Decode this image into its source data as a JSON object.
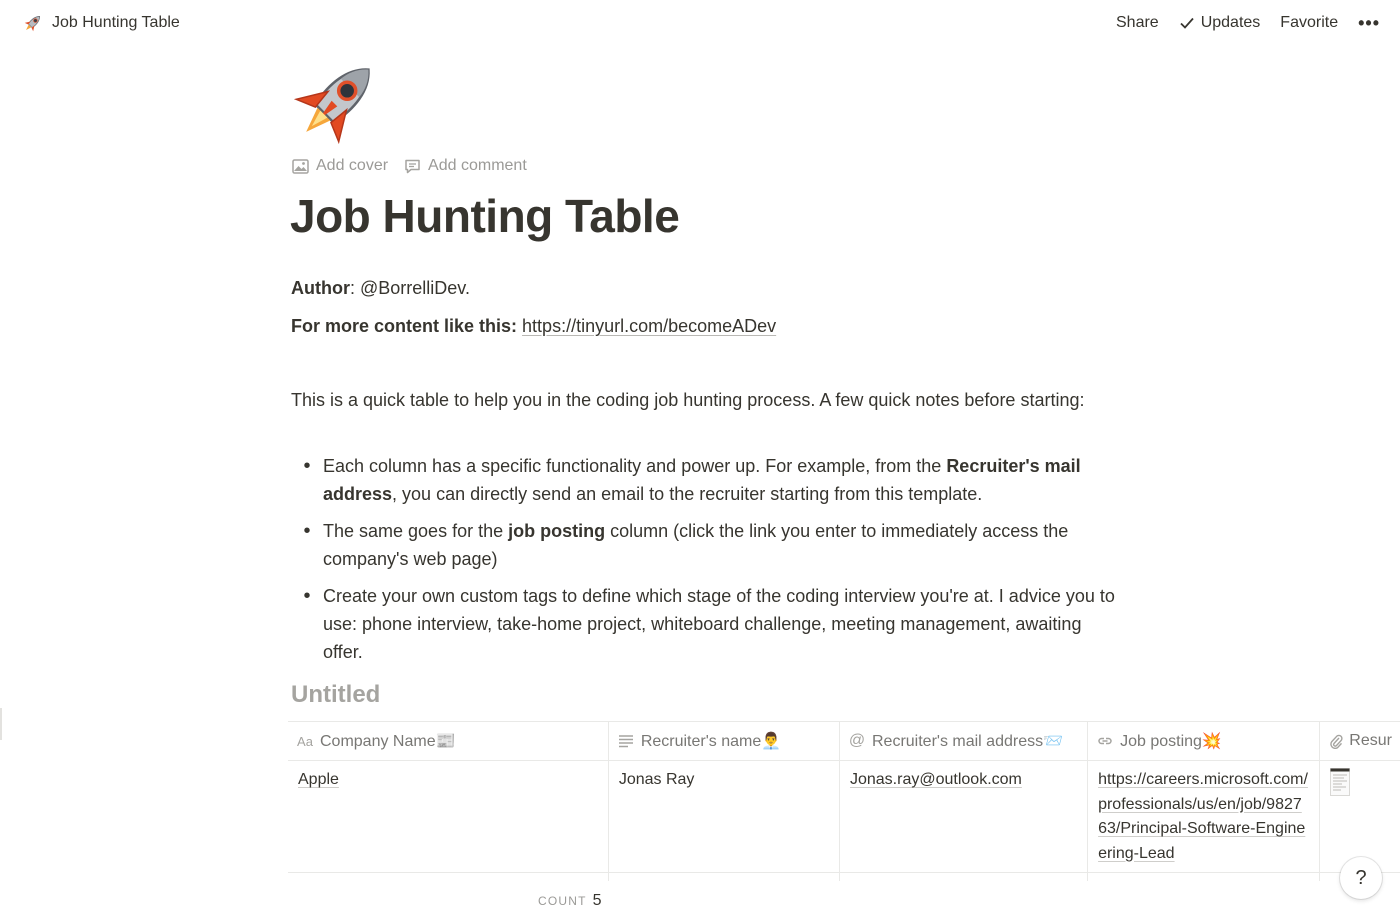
{
  "topbar": {
    "breadcrumb_title": "Job Hunting Table",
    "share_label": "Share",
    "updates_label": "Updates",
    "favorite_label": "Favorite",
    "more_label": "•••"
  },
  "page": {
    "icon": "rocket-icon",
    "add_cover_label": "Add cover",
    "add_comment_label": "Add comment",
    "title": "Job Hunting Table",
    "author_label": "Author",
    "author_value": ": @BorrelliDev.",
    "more_content_label": "For more content like this:",
    "more_content_link": "https://tinyurl.com/becomeADev",
    "intro": "This is a quick table to help you in the coding job hunting process. A few quick notes before starting:",
    "bullets": [
      {
        "before": "Each column has a specific functionality and power up. For example, from the ",
        "bold": "Recruiter's mail address",
        "after": ", you can directly send an email to the recruiter starting from this template."
      },
      {
        "before": "The same goes for the ",
        "bold": "job posting",
        "after": " column (click the link you enter to immediately access the company's web page)"
      },
      {
        "before": "Create your own custom tags to define which stage of the coding interview you're at. I advice you to use: phone interview, take-home project, whiteboard challenge, meeting management, awaiting offer.",
        "bold": "",
        "after": ""
      }
    ]
  },
  "database": {
    "title": "Untitled",
    "columns": [
      {
        "label": "Company Name📰",
        "icon": "title-icon"
      },
      {
        "label": "Recruiter's name👨‍💼",
        "icon": "text-icon"
      },
      {
        "label": "Recruiter's mail address📨",
        "icon": "email-icon"
      },
      {
        "label": "Job posting💥",
        "icon": "url-icon"
      },
      {
        "label": "Resur",
        "icon": "attachment-icon"
      }
    ],
    "rows": [
      {
        "company": "Apple",
        "recruiter": "Jonas Ray",
        "email": "Jonas.ray@outlook.com",
        "job_posting": "https://careers.microsoft.com/professionals/us/en/job/982763/Principal-Software-Engineering-Lead",
        "resume": "document-thumbnail"
      }
    ],
    "count_label": "COUNT",
    "count_value": "5"
  },
  "help_label": "?"
}
